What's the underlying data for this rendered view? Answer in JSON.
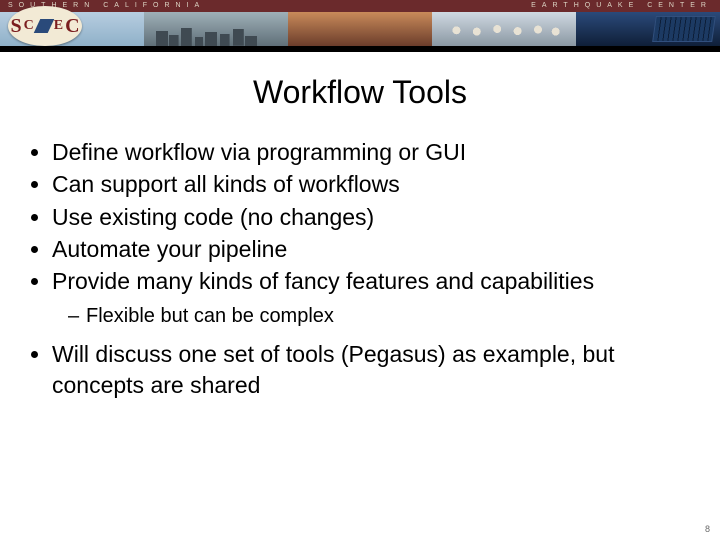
{
  "banner": {
    "org_left": "SOUTHERN CALIFORNIA",
    "org_right": "EARTHQUAKE CENTER",
    "logo_letters": [
      "S",
      "C",
      "E",
      "C"
    ]
  },
  "title": "Workflow Tools",
  "bullets_a": [
    "Define workflow via programming or GUI",
    "Can support all kinds of workflows",
    "Use existing code (no changes)",
    "Automate your pipeline",
    "Provide many kinds of fancy features and capabilities"
  ],
  "sub_a": "Flexible but can be complex",
  "bullets_b": [
    "Will discuss one set of tools (Pegasus) as example, but concepts are shared"
  ],
  "page_number": "8"
}
